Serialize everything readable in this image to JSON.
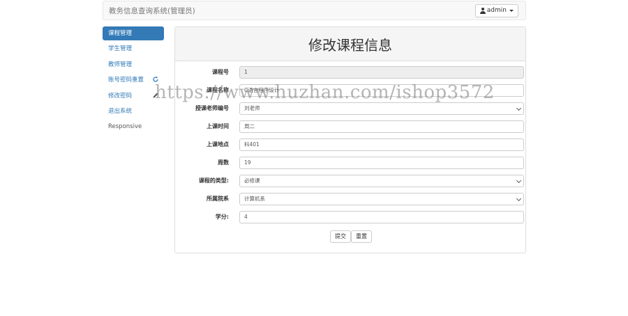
{
  "navbar": {
    "brand": "教务信息查询系统(管理员)",
    "user": "admin"
  },
  "sidebar": {
    "items": [
      {
        "label": "课程管理"
      },
      {
        "label": "学生管理"
      },
      {
        "label": "教师管理"
      },
      {
        "label": "账号密码重置",
        "icon": "refresh-icon"
      },
      {
        "label": "修改密码",
        "icon": "pencil-icon"
      },
      {
        "label": "退出系统"
      },
      {
        "label": "Responsive"
      }
    ]
  },
  "panel": {
    "title": "修改课程信息"
  },
  "form": {
    "course_id": {
      "label": "课程号",
      "value": "1"
    },
    "course_name": {
      "label": "课程名称",
      "value": "C语言程序设计"
    },
    "teacher": {
      "label": "授课老师编号",
      "value": "刘老师"
    },
    "time": {
      "label": "上课时间",
      "value": "周二"
    },
    "place": {
      "label": "上课地点",
      "value": "科401"
    },
    "weeks": {
      "label": "周数",
      "value": "19"
    },
    "type": {
      "label": "课程的类型:",
      "value": "必修课"
    },
    "dept": {
      "label": "所属院系",
      "value": "计算机系"
    },
    "credit": {
      "label": "学分:",
      "value": "4"
    },
    "submit_label": "提交",
    "reset_label": "重置"
  },
  "watermark": "https://www.huzhan.com/ishop3572",
  "colors": {
    "primary": "#337ab7",
    "panel_head_bg": "#f5f5f5",
    "readonly_bg": "#eeeeee"
  }
}
